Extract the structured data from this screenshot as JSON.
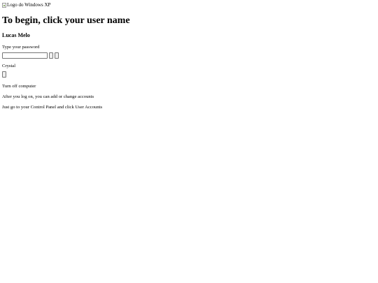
{
  "logo": {
    "alt_text": "Logo do Windows XP"
  },
  "title": "To begin, click your user name",
  "users": [
    {
      "name": "Lucas Melo",
      "password_prompt": "Type your password",
      "password_value": ""
    },
    {
      "name": "Crystal"
    }
  ],
  "footer": {
    "turn_off": "Turn off computer",
    "hint_line1": "After you log on, you can add or change accounts",
    "hint_line2": "Just go to your Control Panel and click User Accounts"
  }
}
